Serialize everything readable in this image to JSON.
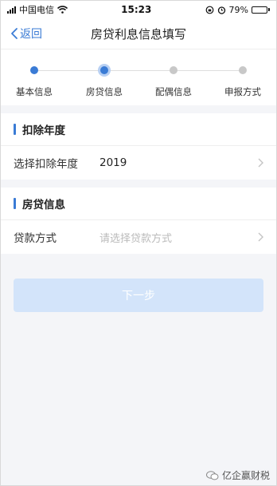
{
  "status_bar": {
    "carrier": "中国电信",
    "time": "15:23",
    "battery_percent": "79%",
    "battery_level": 0.79
  },
  "nav": {
    "back_label": "返回",
    "title": "房贷利息信息填写"
  },
  "steps": [
    {
      "label": "基本信息",
      "state": "done"
    },
    {
      "label": "房贷信息",
      "state": "active"
    },
    {
      "label": "配偶信息",
      "state": "pending"
    },
    {
      "label": "申报方式",
      "state": "pending"
    }
  ],
  "section_year": {
    "title": "扣除年度",
    "row_label": "选择扣除年度",
    "row_value": "2019"
  },
  "section_loan": {
    "title": "房贷信息",
    "row_label": "贷款方式",
    "row_placeholder": "请选择贷款方式"
  },
  "next_button": {
    "label": "下一步"
  },
  "watermark": {
    "text": "亿企赢财税"
  },
  "colors": {
    "accent": "#3a7bd5",
    "button_disabled": "#d3e4fa",
    "background": "#f4f5f8"
  },
  "icons": [
    "wifi-icon",
    "signal-icon",
    "battery-icon",
    "lock-rotation-icon",
    "alarm-icon",
    "back-chevron-icon",
    "chevron-right-icon",
    "wechat-icon"
  ]
}
